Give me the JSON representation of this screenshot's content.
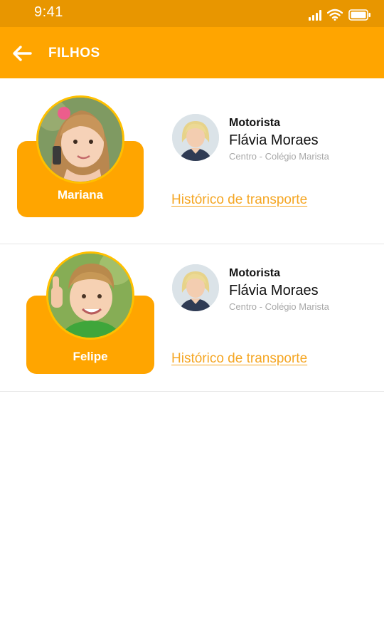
{
  "status_bar": {
    "time": "9:41"
  },
  "app_bar": {
    "title": "FILHOS"
  },
  "children": [
    {
      "name": "Mariana",
      "driver": {
        "label": "Motorista",
        "name": "Flávia Moraes",
        "route": "Centro - Colégio Marista"
      },
      "history_link": "Histórico de transporte"
    },
    {
      "name": "Felipe",
      "driver": {
        "label": "Motorista",
        "name": "Flávia Moraes",
        "route": "Centro - Colégio Marista"
      },
      "history_link": "Histórico de transporte"
    }
  ],
  "colors": {
    "primary": "#FFA500",
    "status_bar": "#E89600",
    "link": "#F5A623"
  },
  "icons": [
    "back-arrow-icon",
    "signal-icon",
    "wifi-icon",
    "battery-icon"
  ]
}
